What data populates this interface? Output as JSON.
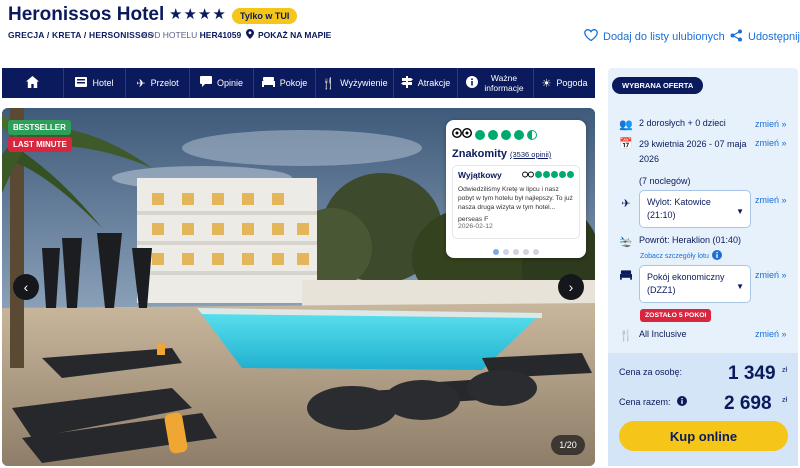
{
  "header": {
    "title": "Heronissos Hotel",
    "stars": "★★★★",
    "tui_badge": "Tylko w TUI",
    "breadcrumb": "GRECJA / KRETA / HERSONISSOS",
    "hotel_code_label": "KOD HOTELU",
    "hotel_code": "HER41059",
    "map_link": "POKAŻ NA MAPIE",
    "favorite": "Dodaj do listy ulubionych",
    "share": "Udostępnij"
  },
  "nav": [
    {
      "label": "",
      "icon": "home-icon"
    },
    {
      "label": "Hotel",
      "icon": "hotel-icon"
    },
    {
      "label": "Przelot",
      "icon": "plane-icon"
    },
    {
      "label": "Opinie",
      "icon": "speech-bubble-icon"
    },
    {
      "label": "Pokoje",
      "icon": "bed-icon"
    },
    {
      "label": "Wyżywienie",
      "icon": "cutlery-icon"
    },
    {
      "label": "Atrakcje",
      "icon": "signpost-icon"
    },
    {
      "label": "Ważne informacje",
      "icon": "info-icon"
    },
    {
      "label": "Pogoda",
      "icon": "sun-icon"
    }
  ],
  "gallery": {
    "tags": [
      {
        "label": "BESTSELLER",
        "color": "#2e9e5b"
      },
      {
        "label": "LAST MINUTE",
        "color": "#d7263d"
      }
    ],
    "counter": "1/20",
    "review": {
      "rating_title": "Znakomity",
      "rating_count": "(3536 opinii)",
      "card_title": "Wyjątkowy",
      "card_text": "Odwiedziliśmy Kretę w lipcu i nasz pobyt w tym hotelu był najlepszy. To już nasza druga wizyta w tym hotel...",
      "author": "perseas F",
      "date": "2026-02-12",
      "bubbles": 4.5
    }
  },
  "offer": {
    "pill": "WYBRANA OFERTA",
    "guests": "2 dorosłych + 0 dzieci",
    "dates": "29 kwietnia 2026 - 07 maja 2026",
    "nights": "(7 noclegów)",
    "departure_line1": "Wylot: Katowice",
    "departure_line2": "(21:10)",
    "return": "Powrót: Heraklion (01:40)",
    "flight_details": "Zobacz szczegóły lotu",
    "room_line1": "Pokój ekonomiczny",
    "room_line2": "(DZZ1)",
    "last_rooms": "ZOSTAŁO 5 POKOI",
    "board": "All Inclusive",
    "change": "zmień »",
    "price_per_person_label": "Cena za osobę:",
    "price_per_person": "1 349",
    "price_total_label": "Cena razem:",
    "price_total": "2 698",
    "currency": "zł",
    "book_button": "Kup online"
  }
}
